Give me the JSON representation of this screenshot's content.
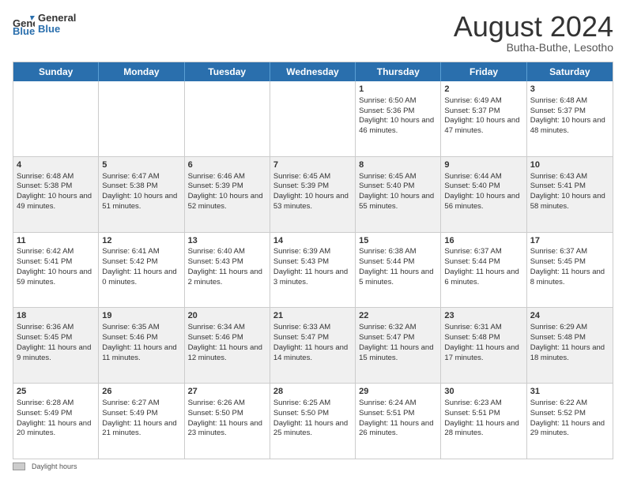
{
  "header": {
    "logo_line1": "General",
    "logo_line2": "Blue",
    "month_title": "August 2024",
    "location": "Butha-Buthe, Lesotho"
  },
  "days_of_week": [
    "Sunday",
    "Monday",
    "Tuesday",
    "Wednesday",
    "Thursday",
    "Friday",
    "Saturday"
  ],
  "rows": [
    {
      "alt": false,
      "cells": [
        {
          "day": "",
          "info": ""
        },
        {
          "day": "",
          "info": ""
        },
        {
          "day": "",
          "info": ""
        },
        {
          "day": "",
          "info": ""
        },
        {
          "day": "1",
          "info": "Sunrise: 6:50 AM\nSunset: 5:36 PM\nDaylight: 10 hours and 46 minutes."
        },
        {
          "day": "2",
          "info": "Sunrise: 6:49 AM\nSunset: 5:37 PM\nDaylight: 10 hours and 47 minutes."
        },
        {
          "day": "3",
          "info": "Sunrise: 6:48 AM\nSunset: 5:37 PM\nDaylight: 10 hours and 48 minutes."
        }
      ]
    },
    {
      "alt": true,
      "cells": [
        {
          "day": "4",
          "info": "Sunrise: 6:48 AM\nSunset: 5:38 PM\nDaylight: 10 hours and 49 minutes."
        },
        {
          "day": "5",
          "info": "Sunrise: 6:47 AM\nSunset: 5:38 PM\nDaylight: 10 hours and 51 minutes."
        },
        {
          "day": "6",
          "info": "Sunrise: 6:46 AM\nSunset: 5:39 PM\nDaylight: 10 hours and 52 minutes."
        },
        {
          "day": "7",
          "info": "Sunrise: 6:45 AM\nSunset: 5:39 PM\nDaylight: 10 hours and 53 minutes."
        },
        {
          "day": "8",
          "info": "Sunrise: 6:45 AM\nSunset: 5:40 PM\nDaylight: 10 hours and 55 minutes."
        },
        {
          "day": "9",
          "info": "Sunrise: 6:44 AM\nSunset: 5:40 PM\nDaylight: 10 hours and 56 minutes."
        },
        {
          "day": "10",
          "info": "Sunrise: 6:43 AM\nSunset: 5:41 PM\nDaylight: 10 hours and 58 minutes."
        }
      ]
    },
    {
      "alt": false,
      "cells": [
        {
          "day": "11",
          "info": "Sunrise: 6:42 AM\nSunset: 5:41 PM\nDaylight: 10 hours and 59 minutes."
        },
        {
          "day": "12",
          "info": "Sunrise: 6:41 AM\nSunset: 5:42 PM\nDaylight: 11 hours and 0 minutes."
        },
        {
          "day": "13",
          "info": "Sunrise: 6:40 AM\nSunset: 5:43 PM\nDaylight: 11 hours and 2 minutes."
        },
        {
          "day": "14",
          "info": "Sunrise: 6:39 AM\nSunset: 5:43 PM\nDaylight: 11 hours and 3 minutes."
        },
        {
          "day": "15",
          "info": "Sunrise: 6:38 AM\nSunset: 5:44 PM\nDaylight: 11 hours and 5 minutes."
        },
        {
          "day": "16",
          "info": "Sunrise: 6:37 AM\nSunset: 5:44 PM\nDaylight: 11 hours and 6 minutes."
        },
        {
          "day": "17",
          "info": "Sunrise: 6:37 AM\nSunset: 5:45 PM\nDaylight: 11 hours and 8 minutes."
        }
      ]
    },
    {
      "alt": true,
      "cells": [
        {
          "day": "18",
          "info": "Sunrise: 6:36 AM\nSunset: 5:45 PM\nDaylight: 11 hours and 9 minutes."
        },
        {
          "day": "19",
          "info": "Sunrise: 6:35 AM\nSunset: 5:46 PM\nDaylight: 11 hours and 11 minutes."
        },
        {
          "day": "20",
          "info": "Sunrise: 6:34 AM\nSunset: 5:46 PM\nDaylight: 11 hours and 12 minutes."
        },
        {
          "day": "21",
          "info": "Sunrise: 6:33 AM\nSunset: 5:47 PM\nDaylight: 11 hours and 14 minutes."
        },
        {
          "day": "22",
          "info": "Sunrise: 6:32 AM\nSunset: 5:47 PM\nDaylight: 11 hours and 15 minutes."
        },
        {
          "day": "23",
          "info": "Sunrise: 6:31 AM\nSunset: 5:48 PM\nDaylight: 11 hours and 17 minutes."
        },
        {
          "day": "24",
          "info": "Sunrise: 6:29 AM\nSunset: 5:48 PM\nDaylight: 11 hours and 18 minutes."
        }
      ]
    },
    {
      "alt": false,
      "cells": [
        {
          "day": "25",
          "info": "Sunrise: 6:28 AM\nSunset: 5:49 PM\nDaylight: 11 hours and 20 minutes."
        },
        {
          "day": "26",
          "info": "Sunrise: 6:27 AM\nSunset: 5:49 PM\nDaylight: 11 hours and 21 minutes."
        },
        {
          "day": "27",
          "info": "Sunrise: 6:26 AM\nSunset: 5:50 PM\nDaylight: 11 hours and 23 minutes."
        },
        {
          "day": "28",
          "info": "Sunrise: 6:25 AM\nSunset: 5:50 PM\nDaylight: 11 hours and 25 minutes."
        },
        {
          "day": "29",
          "info": "Sunrise: 6:24 AM\nSunset: 5:51 PM\nDaylight: 11 hours and 26 minutes."
        },
        {
          "day": "30",
          "info": "Sunrise: 6:23 AM\nSunset: 5:51 PM\nDaylight: 11 hours and 28 minutes."
        },
        {
          "day": "31",
          "info": "Sunrise: 6:22 AM\nSunset: 5:52 PM\nDaylight: 11 hours and 29 minutes."
        }
      ]
    }
  ],
  "footer": {
    "daylight_label": "Daylight hours"
  }
}
